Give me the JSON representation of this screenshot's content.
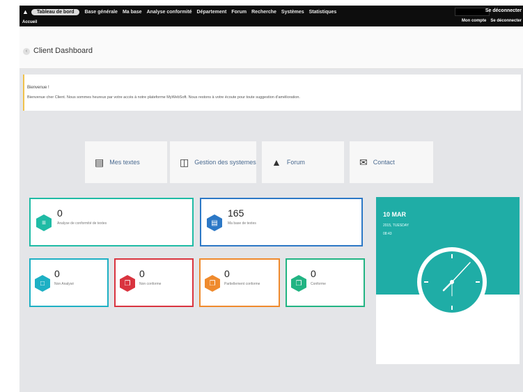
{
  "nav": {
    "items": [
      {
        "label": "Tableau de bord",
        "active": true
      },
      {
        "label": "Base générale",
        "active": false
      },
      {
        "label": "Ma base",
        "active": false
      },
      {
        "label": "Analyse conformité",
        "active": false
      },
      {
        "label": "Département",
        "active": false
      },
      {
        "label": "Forum",
        "active": false
      },
      {
        "label": "Recherche",
        "active": false
      },
      {
        "label": "Systèmes",
        "active": false
      },
      {
        "label": "Statistiques",
        "active": false
      }
    ],
    "logout_label": "Se déconnecter",
    "breadcrumb_home": "Accueil",
    "account_label": "Mon compte",
    "logout_short": "Se déconnecter"
  },
  "page": {
    "title": "Client Dashboard"
  },
  "welcome": {
    "title": "Bienvenue !",
    "message": "Bienvenue cher Client. Nous sommes heureux par votre accès à notre plateforme MyWebSoft. Nous restons à votre écoute pour toute suggestion d'amélioration."
  },
  "quick_links": [
    {
      "label": "Mes textes",
      "icon": "document-icon"
    },
    {
      "label": "Gestion des systemes",
      "icon": "files-icon"
    },
    {
      "label": "Forum",
      "icon": "bank-icon"
    },
    {
      "label": "Contact",
      "icon": "envelope-icon"
    }
  ],
  "stats_wide": [
    {
      "value": "0",
      "label": "Analyse de conformité de textes",
      "color": "#1fbba5"
    },
    {
      "value": "165",
      "label": "Ma base de textes",
      "color": "#2c78c6"
    }
  ],
  "stats_small": [
    {
      "value": "0",
      "label": "Non Analysé",
      "color": "#1eb0c4"
    },
    {
      "value": "0",
      "label": "Non conforme",
      "color": "#d9343f"
    },
    {
      "value": "0",
      "label": "Partiellement conforme",
      "color": "#ef8a2d"
    },
    {
      "value": "0",
      "label": "Conforme",
      "color": "#22b483"
    }
  ],
  "clock": {
    "date": "10 MAR",
    "day": "2015, TUESDAY",
    "time": "08:43",
    "accent": "#1fada6"
  }
}
